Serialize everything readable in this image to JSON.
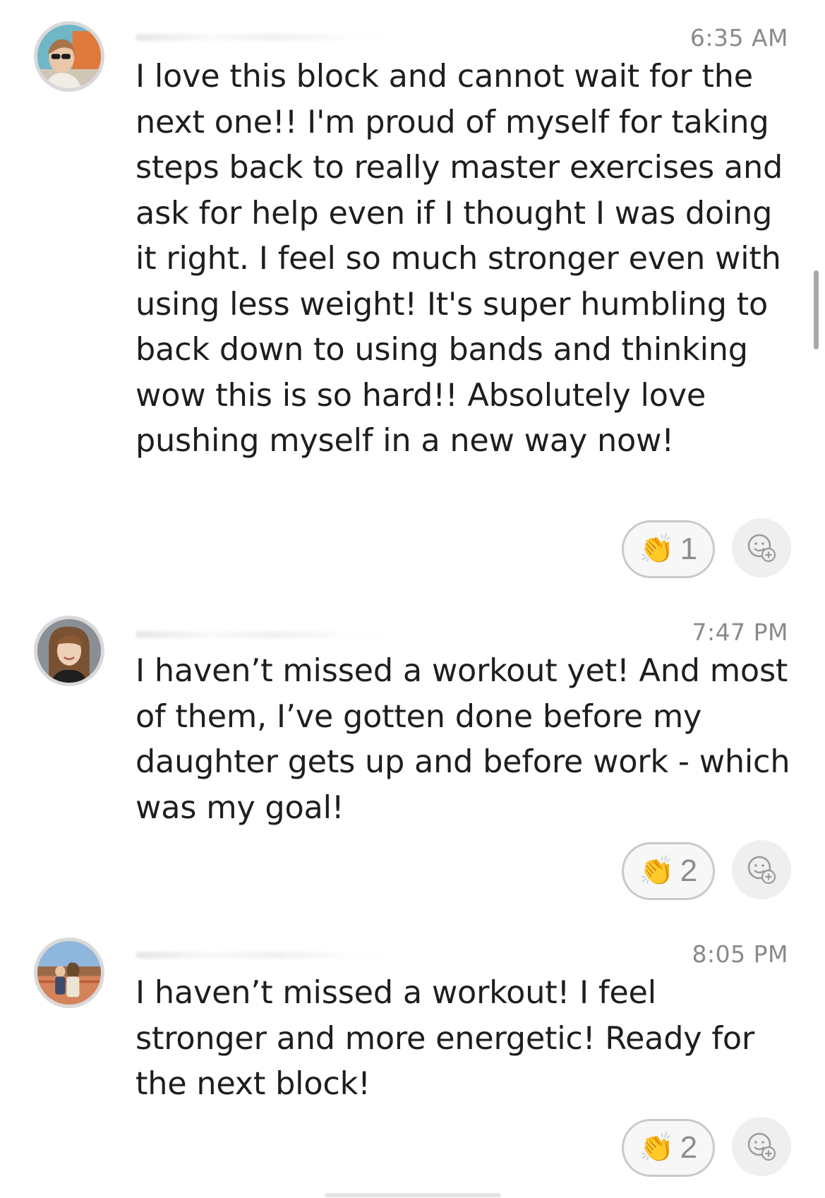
{
  "posts": [
    {
      "time": "6:35 AM",
      "text": "I love this block and cannot wait for the next one!! I'm proud of myself for taking steps back to really master exercises and ask for help even if I thought I was doing it right. I feel so much stronger even with using less weight! It's super humbling to back down to using bands and thinking wow this is so hard!! Absolutely love pushing myself in a new way now!",
      "reaction": {
        "emoji": "👏",
        "count": "1"
      }
    },
    {
      "time": "7:47 PM",
      "text": "I haven’t missed a workout yet! And most of them, I’ve gotten done before my daughter gets up and before work - which was my goal!",
      "reaction": {
        "emoji": "👏",
        "count": "2"
      }
    },
    {
      "time": "8:05 PM",
      "text": "I haven’t missed a workout! I feel stronger and more energetic! Ready for the next block!",
      "reaction": {
        "emoji": "👏",
        "count": "2"
      }
    }
  ],
  "icons": {
    "avatar": "avatar",
    "add_reaction": "add-reaction-icon",
    "clap": "clapping-hands-icon"
  },
  "colors": {
    "background": "#ffffff",
    "text": "#1e1e1e",
    "timestamp": "#8a8a8a",
    "pill_border": "#c9c9c9",
    "add_reaction_bg": "#efefef"
  }
}
